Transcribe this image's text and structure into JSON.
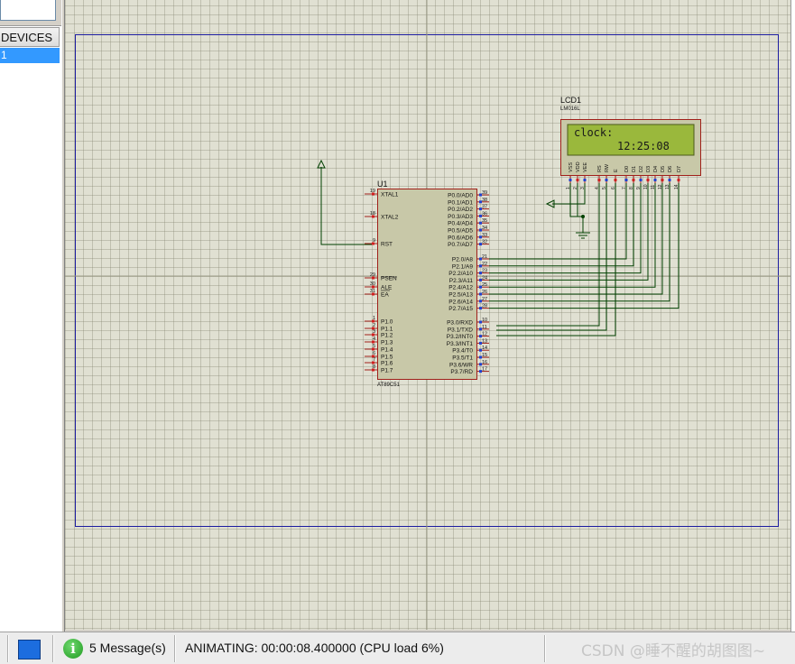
{
  "sidebar": {
    "devices_header": "DEVICES",
    "devices": [
      "1"
    ]
  },
  "schematic": {
    "mcu": {
      "ref": "U1",
      "part": "AT89C51",
      "left_pins": [
        {
          "num": "19",
          "name": "XTAL1"
        },
        {
          "num": "18",
          "name": "XTAL2"
        },
        {
          "num": "9",
          "name": "RST"
        },
        {
          "num": "29",
          "name": "PSEN"
        },
        {
          "num": "30",
          "name": "ALE"
        },
        {
          "num": "31",
          "name": "EA"
        },
        {
          "num": "1",
          "name": "P1.0"
        },
        {
          "num": "2",
          "name": "P1.1"
        },
        {
          "num": "3",
          "name": "P1.2"
        },
        {
          "num": "4",
          "name": "P1.3"
        },
        {
          "num": "5",
          "name": "P1.4"
        },
        {
          "num": "6",
          "name": "P1.5"
        },
        {
          "num": "7",
          "name": "P1.6"
        },
        {
          "num": "8",
          "name": "P1.7"
        }
      ],
      "right_pins": [
        {
          "num": "39",
          "name": "P0.0/AD0"
        },
        {
          "num": "38",
          "name": "P0.1/AD1"
        },
        {
          "num": "37",
          "name": "P0.2/AD2"
        },
        {
          "num": "36",
          "name": "P0.3/AD3"
        },
        {
          "num": "35",
          "name": "P0.4/AD4"
        },
        {
          "num": "34",
          "name": "P0.5/AD5"
        },
        {
          "num": "33",
          "name": "P0.6/AD6"
        },
        {
          "num": "32",
          "name": "P0.7/AD7"
        },
        {
          "num": "21",
          "name": "P2.0/A8"
        },
        {
          "num": "22",
          "name": "P2.1/A9"
        },
        {
          "num": "23",
          "name": "P2.2/A10"
        },
        {
          "num": "24",
          "name": "P2.3/A11"
        },
        {
          "num": "25",
          "name": "P2.4/A12"
        },
        {
          "num": "26",
          "name": "P2.5/A13"
        },
        {
          "num": "27",
          "name": "P2.6/A14"
        },
        {
          "num": "28",
          "name": "P2.7/A15"
        },
        {
          "num": "10",
          "name": "P3.0/RXD"
        },
        {
          "num": "11",
          "name": "P3.1/TXD"
        },
        {
          "num": "12",
          "name": "P3.2/INT0"
        },
        {
          "num": "13",
          "name": "P3.3/INT1"
        },
        {
          "num": "14",
          "name": "P3.4/T0"
        },
        {
          "num": "15",
          "name": "P3.5/T1"
        },
        {
          "num": "16",
          "name": "P3.6/WR"
        },
        {
          "num": "17",
          "name": "P3.7/RD"
        }
      ]
    },
    "lcd": {
      "ref": "LCD1",
      "part": "LM016L",
      "line1": "clock:",
      "line2": "12:25:08",
      "pins": [
        {
          "num": "1",
          "name": "VSS"
        },
        {
          "num": "2",
          "name": "VDD"
        },
        {
          "num": "3",
          "name": "VEE"
        },
        {
          "num": "4",
          "name": "RS"
        },
        {
          "num": "5",
          "name": "RW"
        },
        {
          "num": "6",
          "name": "E"
        },
        {
          "num": "7",
          "name": "D0"
        },
        {
          "num": "8",
          "name": "D1"
        },
        {
          "num": "9",
          "name": "D2"
        },
        {
          "num": "10",
          "name": "D3"
        },
        {
          "num": "11",
          "name": "D4"
        },
        {
          "num": "12",
          "name": "D5"
        },
        {
          "num": "13",
          "name": "D6"
        },
        {
          "num": "14",
          "name": "D7"
        }
      ]
    }
  },
  "statusbar": {
    "messages": "5 Message(s)",
    "status": "ANIMATING: 00:00:08.400000 (CPU load 6%)",
    "watermark": "CSDN @睡不醒的胡图图~"
  },
  "colors": {
    "canvas_bg": "#e0e0d2",
    "sheet_border": "#1c1ca0",
    "wire": "#004000",
    "component_outline": "#a0201a",
    "component_body": "#c8c8a8",
    "lcd_screen": "#9ab83c",
    "selection": "#3399ff",
    "stop_button": "#1c6ddf"
  }
}
